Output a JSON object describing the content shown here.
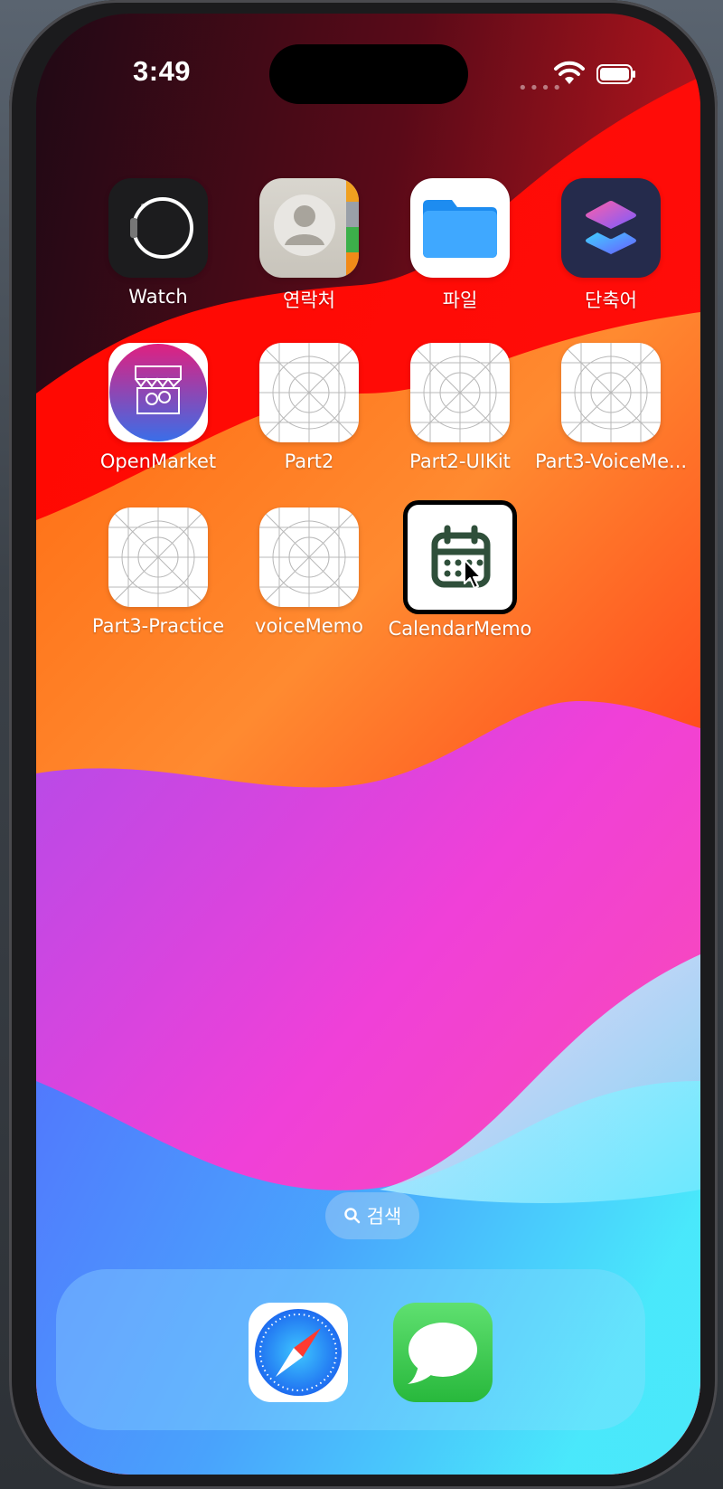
{
  "status": {
    "time": "3:49"
  },
  "apps": [
    {
      "label": "Watch",
      "icon": "watch-icon"
    },
    {
      "label": "연락처",
      "icon": "contacts-icon"
    },
    {
      "label": "파일",
      "icon": "files-icon"
    },
    {
      "label": "단축어",
      "icon": "shortcuts-icon"
    },
    {
      "label": "OpenMarket",
      "icon": "openmarket-icon"
    },
    {
      "label": "Part2",
      "icon": "placeholder-app-icon"
    },
    {
      "label": "Part2-UIKit",
      "icon": "placeholder-app-icon"
    },
    {
      "label": "Part3-VoiceMe...",
      "icon": "placeholder-app-icon"
    },
    {
      "label": "Part3-Practice",
      "icon": "placeholder-app-icon"
    },
    {
      "label": "voiceMemo",
      "icon": "placeholder-app-icon"
    },
    {
      "label": "CalendarMemo",
      "icon": "calendar-icon"
    }
  ],
  "search": {
    "label": "검색"
  },
  "dock": [
    {
      "name": "Safari",
      "icon": "safari-icon"
    },
    {
      "name": "Messages",
      "icon": "messages-icon"
    }
  ]
}
